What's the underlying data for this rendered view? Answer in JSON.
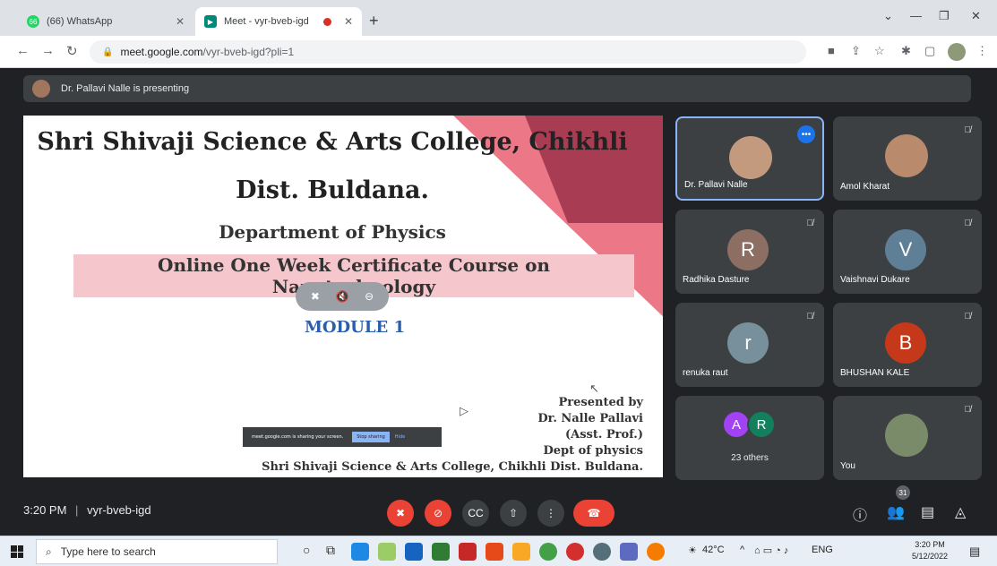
{
  "browser": {
    "tabs": [
      {
        "title": "(66) WhatsApp",
        "favicon_text": "66",
        "active": false
      },
      {
        "title": "Meet - vyr-bveb-igd",
        "favicon_text": "",
        "active": true
      }
    ],
    "new_tab": "+",
    "url_host": "meet.google.com",
    "url_path": "/vyr-bveb-igd?pli=1"
  },
  "presenting_banner": "Dr. Pallavi Nalle is presenting",
  "slide": {
    "title_line1": "Shri Shivaji Science & Arts College, Chikhli",
    "title_line2": "Dist. Buldana.",
    "department": "Department of Physics",
    "course": "Online One Week Certificate Course on Nanotechnology",
    "module": "MODULE 1",
    "presented_by": "Presented  by",
    "presenter": "Dr. Nalle Pallavi",
    "designation": "(Asst. Prof.)",
    "dept": "Dept of physics",
    "college": "Shri Shivaji Science & Arts College, Chikhli Dist. Buldana.",
    "share_text": "meet.google.com is sharing your screen.",
    "stop_sharing": "Stop sharing",
    "hide": "Hide"
  },
  "participants": [
    {
      "name": "Dr. Pallavi Nalle",
      "initial": "",
      "color": "#c49a7e"
    },
    {
      "name": "Amol Kharat",
      "initial": "",
      "color": "#b98a6b"
    },
    {
      "name": "Radhika Dasture",
      "initial": "R",
      "color": "#8d6e63"
    },
    {
      "name": "Vaishnavi Dukare",
      "initial": "V",
      "color": "#5f7f96"
    },
    {
      "name": "renuka raut",
      "initial": "r",
      "color": "#78909c"
    },
    {
      "name": "BHUSHAN KALE",
      "initial": "B",
      "color": "#c5391a"
    },
    {
      "name": "23 others",
      "initial": "",
      "color": ""
    },
    {
      "name": "You",
      "initial": "",
      "color": "#7a8b6a"
    }
  ],
  "others_avatars": [
    {
      "initial": "A",
      "color": "#a142f4"
    },
    {
      "initial": "R",
      "color": "#12805c"
    }
  ],
  "meeting": {
    "time": "3:20 PM",
    "separator": "|",
    "code": "vyr-bveb-igd",
    "participant_count": "31"
  },
  "taskbar": {
    "search_placeholder": "Type here to search",
    "weather": "42°C",
    "language": "ENG",
    "time": "3:20 PM",
    "date": "5/12/2022"
  }
}
